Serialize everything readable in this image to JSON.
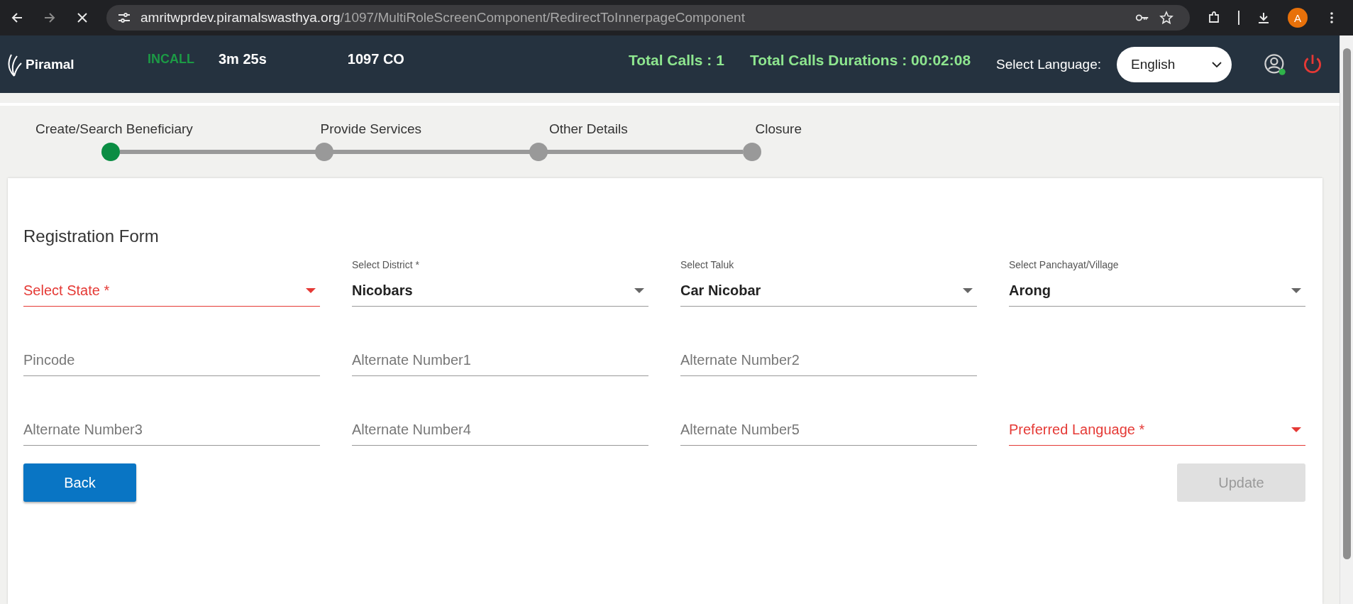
{
  "browser": {
    "url_host": "amritwprdev.piramalswasthya.org",
    "url_path": "/1097/MultiRoleScreenComponent/RedirectToInnerpageComponent",
    "profile_initial": "A"
  },
  "header": {
    "logo_text": "Piramal",
    "call_status": "INCALL",
    "call_timer": "3m 25s",
    "role": "1097 CO",
    "total_calls": "Total Calls : 1",
    "total_duration": "Total Calls Durations : 00:02:08",
    "language_label": "Select Language:",
    "language_value": "English"
  },
  "stepper": [
    {
      "label": "Create/Search Beneficiary",
      "selected": true
    },
    {
      "label": "Provide Services",
      "selected": false
    },
    {
      "label": "Other Details",
      "selected": false
    },
    {
      "label": "Closure",
      "selected": false
    }
  ],
  "form": {
    "title": "Registration Form",
    "rows": [
      [
        {
          "kind": "select",
          "placeholder": "Select State *",
          "error": true
        },
        {
          "kind": "select",
          "label": "Select District *",
          "value": "Nicobars",
          "error": false
        },
        {
          "kind": "select",
          "label": "Select Taluk",
          "value": "Car Nicobar",
          "error": false
        },
        {
          "kind": "select",
          "label": "Select Panchayat/Village",
          "value": "Arong",
          "error": false
        }
      ],
      [
        {
          "kind": "text",
          "placeholder": "Pincode",
          "error": false
        },
        {
          "kind": "text",
          "placeholder": "Alternate Number1",
          "error": false
        },
        {
          "kind": "text",
          "placeholder": "Alternate Number2",
          "error": false
        },
        {
          "kind": "empty"
        }
      ],
      [
        {
          "kind": "text",
          "placeholder": "Alternate Number3",
          "error": false
        },
        {
          "kind": "text",
          "placeholder": "Alternate Number4",
          "error": false
        },
        {
          "kind": "text",
          "placeholder": "Alternate Number5",
          "error": false
        },
        {
          "kind": "select",
          "placeholder": "Preferred Language *",
          "error": true
        }
      ]
    ],
    "buttons": [
      {
        "label": "Back",
        "disabled": false
      },
      {
        "label": "Update",
        "disabled": true
      }
    ]
  }
}
